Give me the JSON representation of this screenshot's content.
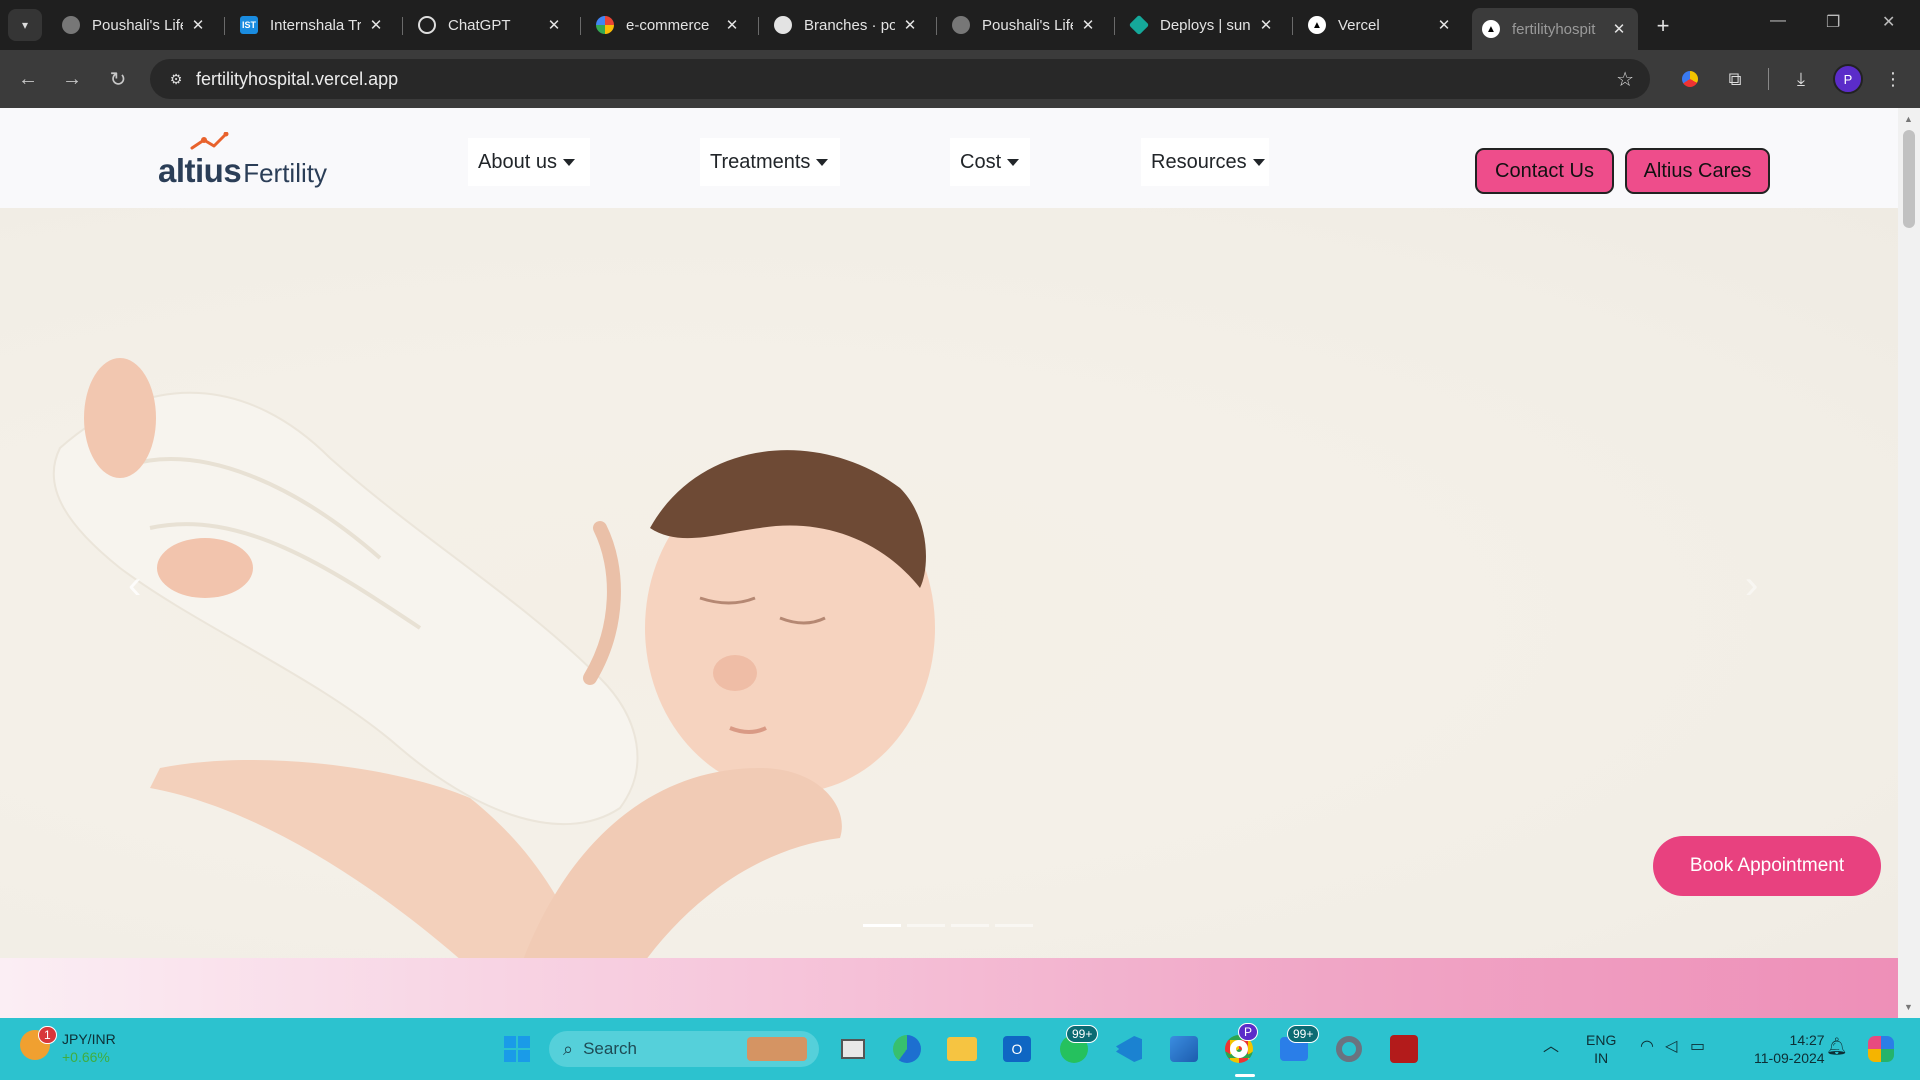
{
  "browser": {
    "tabs": [
      {
        "title": "Poushali's Life",
        "favicon": "globe-gray"
      },
      {
        "title": "Internshala Tr",
        "favicon": "IST"
      },
      {
        "title": "ChatGPT",
        "favicon": "openai"
      },
      {
        "title": "e-commerce",
        "favicon": "google"
      },
      {
        "title": "Branches · po",
        "favicon": "github"
      },
      {
        "title": "Poushali's Life",
        "favicon": "globe-gray"
      },
      {
        "title": "Deploys | sun",
        "favicon": "netlify"
      },
      {
        "title": "Vercel",
        "favicon": "vercel"
      },
      {
        "title": "fertilityhospit",
        "favicon": "vercel"
      }
    ],
    "url": "fertilityhospital.vercel.app",
    "profile_initial": "P"
  },
  "site": {
    "logo": {
      "part1": "altius",
      "part2": "Fertility"
    },
    "menu": [
      {
        "label": "About us"
      },
      {
        "label": "Treatments"
      },
      {
        "label": "Cost"
      },
      {
        "label": "Resources"
      }
    ],
    "buttons": {
      "contact": "Contact Us",
      "cares": "Altius Cares"
    },
    "hero": {
      "book_label": "Book Appointment",
      "slides": 4,
      "active_slide": 1
    },
    "colors": {
      "brand_pink": "#ee4d8b",
      "logo_navy": "#2b3e57",
      "logo_orange": "#e8622c"
    }
  },
  "taskbar": {
    "widget": {
      "title": "JPY/INR",
      "subtitle": "+0.66%",
      "badge": "1"
    },
    "search_placeholder": "Search",
    "whatsapp_badge": "99+",
    "teams_badge": "99+",
    "lang": {
      "line1": "ENG",
      "line2": "IN"
    },
    "clock": {
      "time": "14:27",
      "date": "11-09-2024"
    }
  }
}
